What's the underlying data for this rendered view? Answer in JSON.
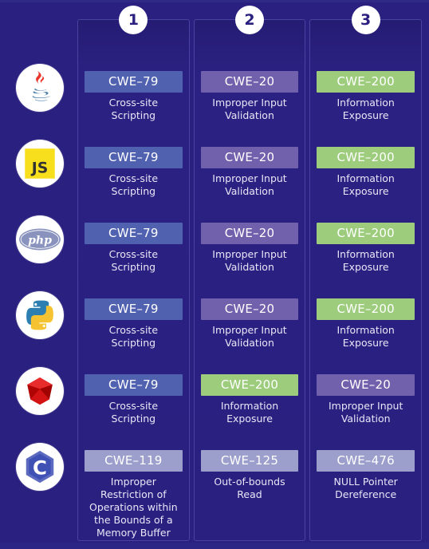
{
  "theme": {
    "background": "#2a2080",
    "panel_border": "#4a42a0",
    "badge_text": "#ffffff",
    "desc_text": "#e8e6f7",
    "rank_circle_bg": "#ffffff",
    "rank_circle_text": "#2a2080",
    "color_blue": "#5061b0",
    "color_purple": "#7160ac",
    "color_green": "#9ccc7c",
    "color_lavender": "#9c9fcc"
  },
  "ranks": [
    {
      "label": "1"
    },
    {
      "label": "2"
    },
    {
      "label": "3"
    }
  ],
  "languages": [
    {
      "name": "java",
      "icon": "java-icon"
    },
    {
      "name": "javascript",
      "icon": "javascript-icon"
    },
    {
      "name": "php",
      "icon": "php-icon"
    },
    {
      "name": "python",
      "icon": "python-icon"
    },
    {
      "name": "ruby",
      "icon": "ruby-icon"
    },
    {
      "name": "c",
      "icon": "c-icon"
    }
  ],
  "columns": [
    {
      "rank": "1",
      "cells": [
        {
          "cwe": "CWE–79",
          "desc": "Cross-site Scripting",
          "color": "#5061b0"
        },
        {
          "cwe": "CWE–79",
          "desc": "Cross-site Scripting",
          "color": "#5061b0"
        },
        {
          "cwe": "CWE–79",
          "desc": "Cross-site Scripting",
          "color": "#5061b0"
        },
        {
          "cwe": "CWE–79",
          "desc": "Cross-site Scripting",
          "color": "#5061b0"
        },
        {
          "cwe": "CWE–79",
          "desc": "Cross-site Scripting",
          "color": "#5061b0"
        },
        {
          "cwe": "CWE–119",
          "desc": "Improper Restriction of Operations within the Bounds of a Memory Buffer",
          "color": "#9c9fcc"
        }
      ]
    },
    {
      "rank": "2",
      "cells": [
        {
          "cwe": "CWE–20",
          "desc": "Improper Input Validation",
          "color": "#7160ac"
        },
        {
          "cwe": "CWE–20",
          "desc": "Improper Input Validation",
          "color": "#7160ac"
        },
        {
          "cwe": "CWE–20",
          "desc": "Improper Input Validation",
          "color": "#7160ac"
        },
        {
          "cwe": "CWE–20",
          "desc": "Improper Input Validation",
          "color": "#7160ac"
        },
        {
          "cwe": "CWE–200",
          "desc": "Information Exposure",
          "color": "#9ccc7c"
        },
        {
          "cwe": "CWE–125",
          "desc": "Out-of-bounds Read",
          "color": "#9c9fcc"
        }
      ]
    },
    {
      "rank": "3",
      "cells": [
        {
          "cwe": "CWE–200",
          "desc": "Information Exposure",
          "color": "#9ccc7c"
        },
        {
          "cwe": "CWE–200",
          "desc": "Information Exposure",
          "color": "#9ccc7c"
        },
        {
          "cwe": "CWE–200",
          "desc": "Information Exposure",
          "color": "#9ccc7c"
        },
        {
          "cwe": "CWE–200",
          "desc": "Information Exposure",
          "color": "#9ccc7c"
        },
        {
          "cwe": "CWE–20",
          "desc": "Improper Input Validation",
          "color": "#7160ac"
        },
        {
          "cwe": "CWE–476",
          "desc": "NULL Pointer Dereference",
          "color": "#9c9fcc"
        }
      ]
    }
  ]
}
